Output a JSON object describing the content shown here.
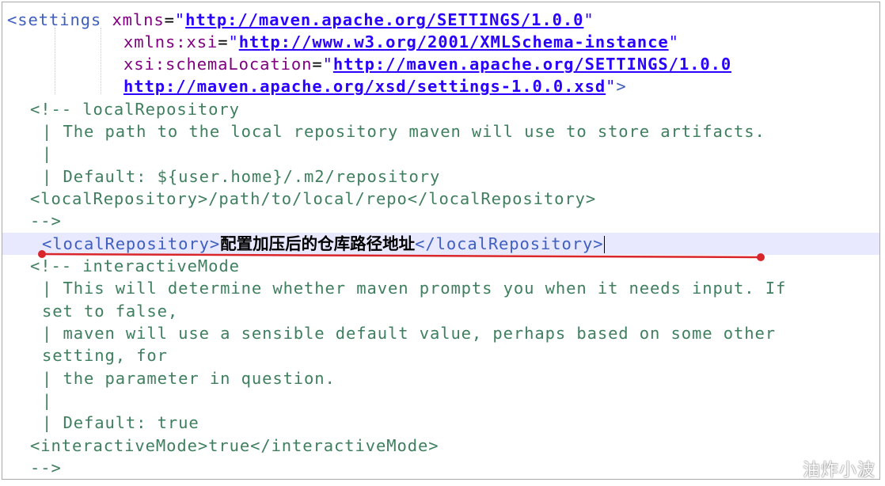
{
  "editor": {
    "root_tag": "<settings",
    "attrs": {
      "xmlns_name": "xmlns",
      "xmlns_value": "http://maven.apache.org/SETTINGS/1.0.0",
      "xsi_name": "xmlns:xsi",
      "xsi_value": "http://www.w3.org/2001/XMLSchema-instance",
      "schema_name": "xsi:schemaLocation",
      "schema_value_1": "http://maven.apache.org/SETTINGS/1.0.0",
      "schema_value_2": "http://maven.apache.org/xsd/settings-1.0.0.xsd",
      "close": ">"
    },
    "comment_local": {
      "open": "<!-- localRepository",
      "line1": "| The path to the local repository maven will use to store artifacts.",
      "line2": "|",
      "line3": "| Default: ${user.home}/.m2/repository",
      "example": "<localRepository>/path/to/local/repo</localRepository>",
      "close": "-->"
    },
    "edited_line": {
      "open_tag": "<localRepository>",
      "value": "配置加压后的仓库路径地址",
      "close_tag": "</localRepository>"
    },
    "comment_interactive": {
      "open": "<!-- interactiveMode",
      "line1": "| This will determine whether maven prompts you when it needs input. If",
      "line2": "set to false,",
      "line3": "| maven will use a sensible default value, perhaps based on some other",
      "line4": "setting, for",
      "line5": "| the parameter in question.",
      "line6": "|",
      "line7": "| Default: true",
      "example": "<interactiveMode>true</interactiveMode>",
      "close": "-->"
    }
  },
  "watermark": "油炸小波",
  "colors": {
    "tag": "#3f5fbf",
    "attribute": "#7f007f",
    "value": "#2a00ff",
    "comment": "#3f7f5f",
    "current_line": "#e8e8ff",
    "annotation_underline": "#d9262b"
  }
}
